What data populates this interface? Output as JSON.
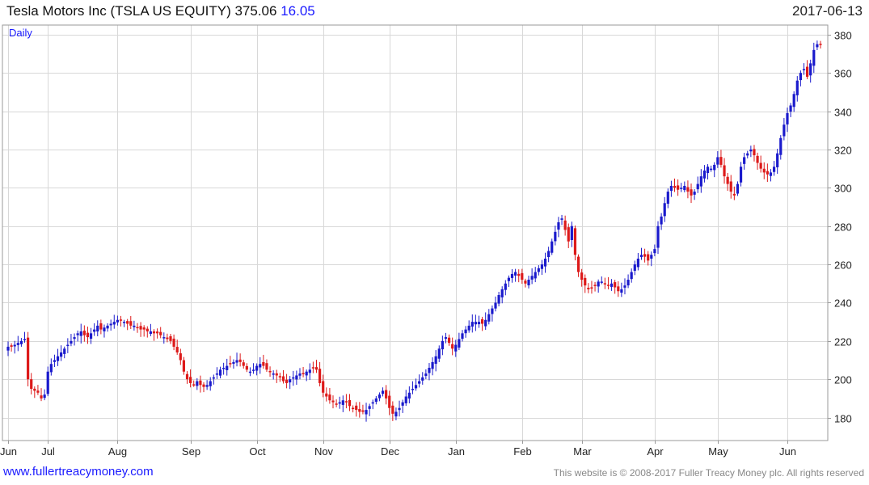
{
  "header": {
    "title": "Tesla Motors Inc (TSLA US EQUITY) 375.06",
    "change": "16.05",
    "date": "2017-06-13"
  },
  "footer": {
    "site": "www.fullertreacymoney.com",
    "copyright": "This website is © 2008-2017 Fuller Treacy Money plc. All rights reserved"
  },
  "colors": {
    "up": "#1a1acc",
    "down": "#dd1a1a",
    "grid": "#d8d8d8",
    "frame": "#9a9a9a"
  },
  "chart_data": {
    "type": "candlestick",
    "label": "Daily",
    "ylim": [
      168,
      385
    ],
    "yticks": [
      180,
      200,
      220,
      240,
      260,
      280,
      300,
      320,
      340,
      360,
      380
    ],
    "months": [
      "Jun",
      "Jul",
      "Aug",
      "Sep",
      "Oct",
      "Nov",
      "Dec",
      "Jan",
      "Feb",
      "Mar",
      "Apr",
      "May",
      "Jun"
    ],
    "month_start_index": [
      0,
      12,
      33,
      55,
      75,
      95,
      115,
      135,
      155,
      173,
      195,
      214,
      235
    ],
    "close": [
      217,
      217,
      218,
      219,
      220,
      221,
      200,
      195,
      194,
      193,
      190,
      192,
      204,
      208,
      210,
      212,
      214,
      216,
      218,
      220,
      222,
      224,
      225,
      223,
      222,
      224,
      226,
      228,
      226,
      227,
      228,
      229,
      230,
      231,
      231,
      230,
      229,
      228,
      228,
      227,
      226,
      226,
      225,
      225,
      224,
      224,
      223,
      222,
      221,
      220,
      217,
      214,
      210,
      204,
      200,
      198,
      197,
      199,
      197,
      196,
      197,
      199,
      201,
      203,
      205,
      206,
      207,
      208,
      209,
      210,
      209,
      207,
      205,
      204,
      205,
      207,
      208,
      207,
      205,
      204,
      203,
      202,
      201,
      199,
      198,
      200,
      201,
      202,
      203,
      203,
      204,
      205,
      206,
      205,
      198,
      193,
      191,
      189,
      188,
      187,
      188,
      189,
      188,
      186,
      185,
      184,
      183,
      183,
      184,
      186,
      188,
      190,
      192,
      194,
      190,
      185,
      182,
      183,
      185,
      188,
      191,
      193,
      195,
      197,
      199,
      201,
      203,
      206,
      209,
      212,
      216,
      220,
      222,
      219,
      216,
      218,
      221,
      224,
      226,
      228,
      230,
      230,
      230,
      229,
      231,
      234,
      237,
      240,
      244,
      247,
      250,
      253,
      255,
      256,
      254,
      252,
      250,
      252,
      254,
      256,
      258,
      260,
      263,
      267,
      272,
      277,
      282,
      284,
      278,
      272,
      280,
      265,
      256,
      252,
      249,
      247,
      248,
      249,
      251,
      251,
      250,
      249,
      250,
      248,
      246,
      247,
      249,
      252,
      256,
      260,
      263,
      265,
      264,
      262,
      265,
      268,
      280,
      285,
      292,
      298,
      301,
      300,
      299,
      300,
      301,
      298,
      296,
      298,
      302,
      306,
      309,
      311,
      310,
      312,
      316,
      312,
      306,
      302,
      298,
      296,
      302,
      311,
      316,
      318,
      320,
      317,
      313,
      310,
      308,
      307,
      308,
      311,
      318,
      326,
      333,
      339,
      343,
      349,
      356,
      360,
      362,
      358,
      365,
      372,
      375,
      375.06
    ]
  }
}
